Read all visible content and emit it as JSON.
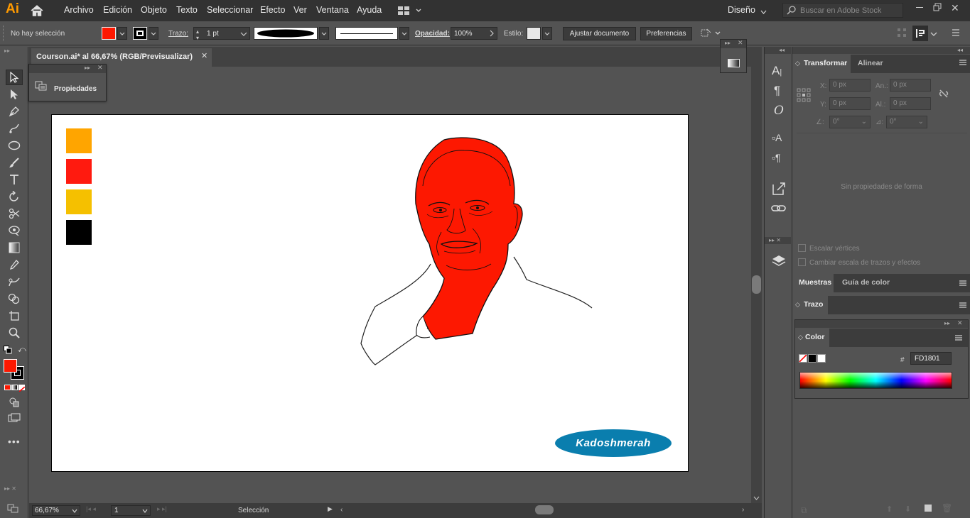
{
  "app": {
    "logo": "Ai",
    "workspace": "Diseño",
    "search_placeholder": "Buscar en Adobe Stock"
  },
  "menu": [
    "Archivo",
    "Edición",
    "Objeto",
    "Texto",
    "Seleccionar",
    "Efecto",
    "Ver",
    "Ventana",
    "Ayuda"
  ],
  "control": {
    "selection": "No hay selección",
    "stroke_label": "Trazo:",
    "stroke_weight": "1 pt",
    "opacity_label": "Opacidad:",
    "opacity_value": "100%",
    "style_label": "Estilo:",
    "fit_button": "Ajustar documento",
    "prefs_button": "Preferencias"
  },
  "document": {
    "tab_title": "Courson.ai* al 66,67% (RGB/Previsualizar)"
  },
  "floating": {
    "properties": "Propiedades"
  },
  "artwork": {
    "logo_text": "Kadoshmerah",
    "swatches": [
      "#FFA500",
      "#FF1A0F",
      "#F5C000",
      "#000000"
    ],
    "fill_color": "#FD1801"
  },
  "status": {
    "zoom": "66,67%",
    "page": "1",
    "tool": "Selección"
  },
  "panels": {
    "transform_tab": "Transformar",
    "align_tab": "Alinear",
    "x_label": "X:",
    "x_value": "0 px",
    "y_label": "Y:",
    "y_value": "0 px",
    "w_label": "An.:",
    "w_value": "0 px",
    "h_label": "Al.:",
    "h_value": "0 px",
    "angle_value": "0°",
    "shear_value": "0°",
    "no_props": "Sin propiedades de forma",
    "scale_corners": "Escalar vértices",
    "scale_strokes": "Cambiar escala de trazos y efectos",
    "swatches_tab": "Muestras",
    "guide_tab": "Guía de color",
    "stroke_tab": "Trazo",
    "color_tab": "Color",
    "hex_label": "#",
    "hex_value": "FD1801"
  }
}
